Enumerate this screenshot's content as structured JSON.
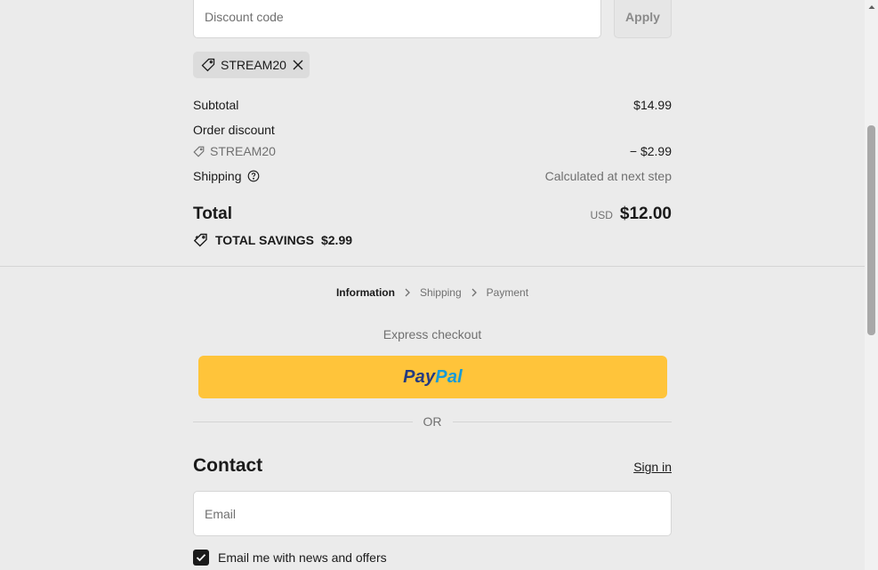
{
  "discount": {
    "placeholder": "Discount code",
    "apply_label": "Apply",
    "applied_code": "STREAM20"
  },
  "summary": {
    "subtotal_label": "Subtotal",
    "subtotal_value": "$14.99",
    "order_discount_label": "Order discount",
    "discount_code": "STREAM20",
    "discount_value": "− $2.99",
    "shipping_label": "Shipping",
    "shipping_value": "Calculated at next step",
    "total_label": "Total",
    "currency": "USD",
    "total_value": "$12.00",
    "savings_label": "TOTAL SAVINGS",
    "savings_value": "$2.99"
  },
  "breadcrumb": {
    "steps": [
      "Information",
      "Shipping",
      "Payment"
    ]
  },
  "express": {
    "label": "Express checkout",
    "paypal_part1": "Pay",
    "paypal_part2": "Pal",
    "or_label": "OR"
  },
  "contact": {
    "title": "Contact",
    "signin_label": "Sign in",
    "email_placeholder": "Email",
    "newsletter_label": "Email me with news and offers",
    "newsletter_checked": true
  },
  "colors": {
    "background": "#ebebeb",
    "paypal_yellow": "#ffc43a",
    "paypal_dark_blue": "#253b80",
    "paypal_light_blue": "#179bd7"
  }
}
